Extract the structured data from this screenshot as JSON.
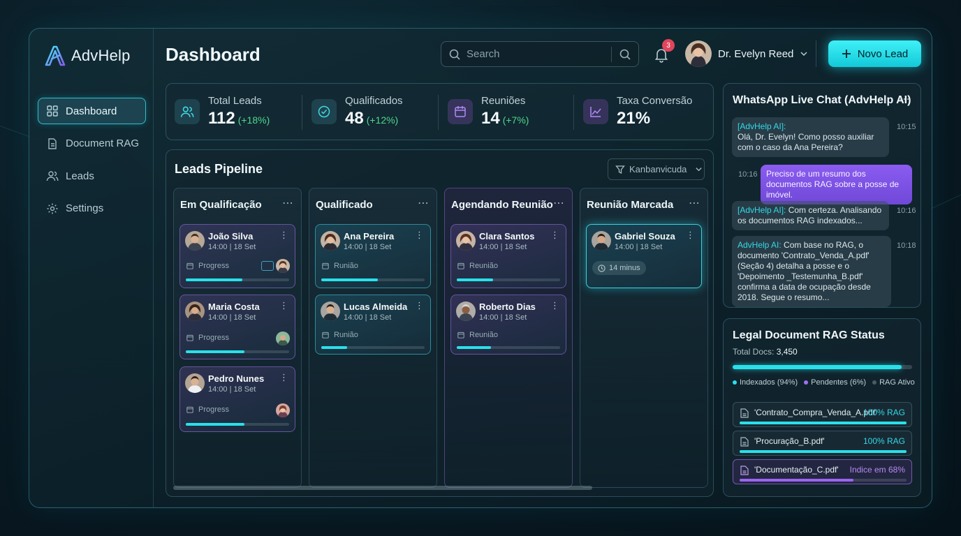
{
  "app": {
    "name": "AdvHelp"
  },
  "sidebar": {
    "items": [
      {
        "label": "Dashboard",
        "icon": "grid-icon",
        "active": true
      },
      {
        "label": "Document RAG",
        "icon": "document-icon"
      },
      {
        "label": "Leads",
        "icon": "users-icon"
      },
      {
        "label": "Settings",
        "icon": "gear-icon"
      }
    ]
  },
  "header": {
    "title": "Dashboard",
    "search_placeholder": "Search",
    "notification_count": "3",
    "user_name": "Dr. Evelyn Reed",
    "new_lead_label": "Novo Lead"
  },
  "stats": [
    {
      "label": "Total Leads",
      "value": "112",
      "delta": "(+18%)",
      "icon": "users-icon"
    },
    {
      "label": "Qualificados",
      "value": "48",
      "delta": "(+12%)",
      "icon": "check-circle-icon"
    },
    {
      "label": "Reuniões",
      "value": "14",
      "delta": "(+7%)",
      "icon": "calendar-icon"
    },
    {
      "label": "Taxa Conversão",
      "value": "21%",
      "delta": "",
      "icon": "trend-chart-icon"
    }
  ],
  "pipeline": {
    "title": "Leads Pipeline",
    "view_select": "Kanbanvicuda",
    "columns": [
      {
        "title": "Em Qualificação",
        "cards": [
          {
            "name": "João Silva",
            "time": "14:00 | 18 Set",
            "tag": "Progress",
            "progress": 0.55
          },
          {
            "name": "Maria Costa",
            "time": "14:00 | 18 Set",
            "tag": "Progress",
            "progress": 0.57
          },
          {
            "name": "Pedro Nunes",
            "time": "14:00 | 18 Set",
            "tag": "Progress",
            "progress": 0.57
          }
        ]
      },
      {
        "title": "Qualificado",
        "cards": [
          {
            "name": "Ana Pereira",
            "time": "14:00 | 18 Set",
            "tag": "Runião",
            "progress": 0.55
          },
          {
            "name": "Lucas Almeida",
            "time": "14:00 | 18 Set",
            "tag": "Runião",
            "progress": 0.25
          }
        ]
      },
      {
        "title": "Agendando Reunião",
        "cards": [
          {
            "name": "Clara Santos",
            "time": "14:00 | 18 Set",
            "tag": "Reunião",
            "progress": 0.35
          },
          {
            "name": "Roberto Dias",
            "time": "14:00 | 18 Set",
            "tag": "Reunião",
            "progress": 0.33
          }
        ]
      },
      {
        "title": "Reunião Marcada",
        "cards": [
          {
            "name": "Gabriel Souza",
            "time": "14:00 | 18 Set",
            "chip": "14 minus"
          }
        ]
      }
    ]
  },
  "chat": {
    "title": "WhatsApp Live Chat (AdvHelp AI)",
    "messages": [
      {
        "sender": "[AdvHelp AI]:",
        "text": "Olá, Dr. Evelyn! Como posso auxiliar com o caso da Ana Pereira?",
        "time": "10:15"
      },
      {
        "sender": "",
        "text": "Preciso de um resumo dos documentos RAG sobre a posse de imóvel.",
        "time": "10:16"
      },
      {
        "sender": "[AdvHelp AI]:",
        "text": "Com certeza. Analisando os documentos RAG indexados...",
        "time": "10:16"
      },
      {
        "sender": "AdvHelp AI:",
        "text": "Com base no RAG, o documento 'Contrato_Venda_A.pdf' (Seção 4) detalha a posse e o 'Depoimento _Testemunha_B.pdf' confirma a data de ocupação desde 2018. Segue o resumo...",
        "time": "10:18"
      }
    ]
  },
  "rag": {
    "title": "Legal Document RAG Status",
    "total_label": "Total Docs:",
    "total_value": "3,450",
    "indexed_fraction": 0.94,
    "legend": [
      {
        "label": "Indexados (94%)",
        "color": "#29e0ea"
      },
      {
        "label": "Pendentes (6%)",
        "color": "#a070f0"
      },
      {
        "label": "RAG Ativo",
        "color": "#4a5a62"
      }
    ],
    "docs": [
      {
        "name": "'Contrato_Compra_Venda_A.pdf'",
        "status": "100% RAG",
        "progress": 1.0
      },
      {
        "name": "'Procuração_B.pdf'",
        "status": "100% RAG",
        "progress": 1.0
      },
      {
        "name": "'Documentação_C.pdf'",
        "status": "Indice em 68%",
        "progress": 0.68
      }
    ]
  },
  "colors": {
    "accent": "#29e0ea",
    "purple": "#8a5cf0",
    "positive": "#4fd88c",
    "badge": "#e0455d"
  }
}
